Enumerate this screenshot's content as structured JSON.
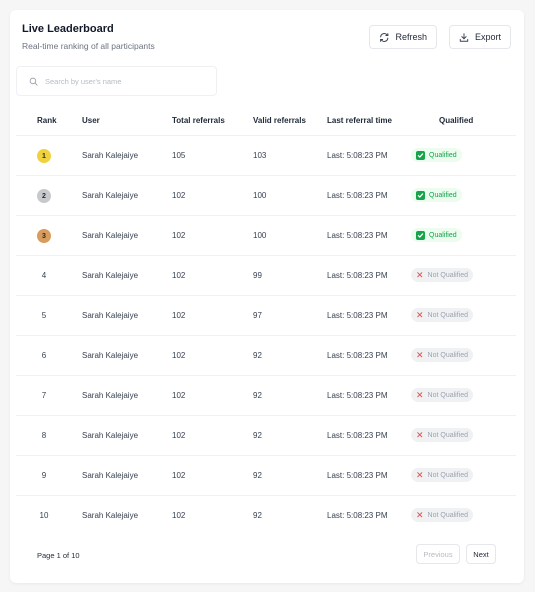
{
  "header": {
    "title": "Live Leaderboard",
    "subtitle": "Real-time ranking of all participants",
    "refresh_label": "Refresh",
    "export_label": "Export",
    "refresh_icon": "refresh-icon",
    "export_icon": "download-icon"
  },
  "search": {
    "placeholder": "Search by user's name",
    "value": ""
  },
  "table": {
    "columns": [
      "Rank",
      "User",
      "Total referrals",
      "Valid referrals",
      "Last referral time",
      "Qualified"
    ],
    "rows": [
      {
        "rank": "1",
        "user": "Sarah Kalejaiye",
        "total": "105",
        "valid": "103",
        "time": "Last: 5:08:23 PM",
        "qualified": "Qualified"
      },
      {
        "rank": "2",
        "user": "Sarah Kalejaiye",
        "total": "102",
        "valid": "100",
        "time": "Last: 5:08:23 PM",
        "qualified": "Qualified"
      },
      {
        "rank": "3",
        "user": "Sarah Kalejaiye",
        "total": "102",
        "valid": "100",
        "time": "Last: 5:08:23 PM",
        "qualified": "Qualified"
      },
      {
        "rank": "4",
        "user": "Sarah Kalejaiye",
        "total": "102",
        "valid": "99",
        "time": "Last: 5:08:23 PM",
        "qualified": "Not Qualified"
      },
      {
        "rank": "5",
        "user": "Sarah Kalejaiye",
        "total": "102",
        "valid": "97",
        "time": "Last: 5:08:23 PM",
        "qualified": "Not Qualified"
      },
      {
        "rank": "6",
        "user": "Sarah Kalejaiye",
        "total": "102",
        "valid": "92",
        "time": "Last: 5:08:23 PM",
        "qualified": "Not Qualified"
      },
      {
        "rank": "7",
        "user": "Sarah Kalejaiye",
        "total": "102",
        "valid": "92",
        "time": "Last: 5:08:23 PM",
        "qualified": "Not Qualified"
      },
      {
        "rank": "8",
        "user": "Sarah Kalejaiye",
        "total": "102",
        "valid": "92",
        "time": "Last: 5:08:23 PM",
        "qualified": "Not Qualified"
      },
      {
        "rank": "9",
        "user": "Sarah Kalejaiye",
        "total": "102",
        "valid": "92",
        "time": "Last: 5:08:23 PM",
        "qualified": "Not Qualified"
      },
      {
        "rank": "10",
        "user": "Sarah Kalejaiye",
        "total": "102",
        "valid": "92",
        "time": "Last: 5:08:23 PM",
        "qualified": "Not Qualified"
      }
    ]
  },
  "medals": {
    "gold": "#f0d23c",
    "silver": "#c8c9cc",
    "bronze": "#d99c5a"
  },
  "colors": {
    "qualified": "#16a34a",
    "not_qualified": "#ef4444"
  },
  "pagination": {
    "page_text": "Page 1 of 10",
    "prev_label": "Previous",
    "next_label": "Next"
  }
}
